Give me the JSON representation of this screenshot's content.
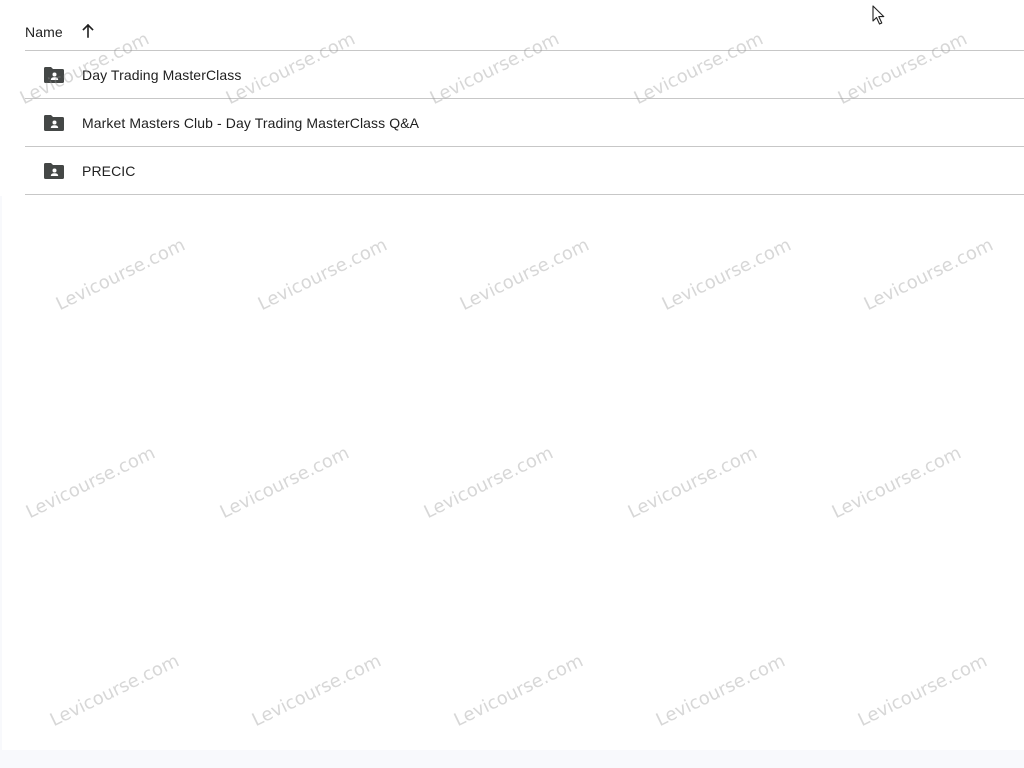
{
  "header": {
    "name_label": "Name",
    "sort_icon": "arrow-up-icon"
  },
  "rows": [
    {
      "label": "Day Trading MasterClass",
      "icon": "shared-folder-icon"
    },
    {
      "label": "Market Masters Club - Day Trading MasterClass Q&A",
      "icon": "shared-folder-icon"
    },
    {
      "label": "PRECIC",
      "icon": "shared-folder-icon"
    }
  ],
  "watermark": {
    "text": "Levicourse.com"
  },
  "colors": {
    "text": "#1f1f1f",
    "divider": "#c7c7c7",
    "icon": "#444746"
  }
}
